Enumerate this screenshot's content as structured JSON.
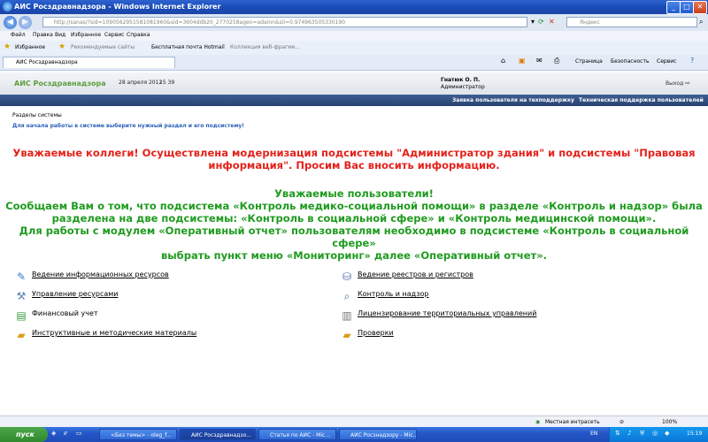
{
  "window": {
    "title": "АИС Росздравнадзора - Windows Internet Explorer"
  },
  "address_bar": {
    "url": "http://sanas/?sid=1090562951581081960&sid=3604ddb20_2770258agen=adainn&sil=0.974963505330190",
    "search_placeholder": "Яндекс"
  },
  "menu": {
    "items": [
      "Файл",
      "Правка",
      "Вид",
      "Избранное",
      "Сервис",
      "Справка"
    ]
  },
  "favorites_bar": {
    "favorites_label": "Избранное",
    "items": [
      "Рекомендуемые сайты",
      "Бесплатная почта Hotmail",
      "Коллекция веб-фрагме..."
    ]
  },
  "tabs": {
    "active": "АИС Росздравнадзора"
  },
  "command_bar": {
    "page": "Страница",
    "security": "Безопасность",
    "tools": "Сервис",
    "help_icon": "question-icon"
  },
  "site_header": {
    "name": "АИС Росздравнадзора",
    "date": "28 апреля 2012",
    "time": "15 39",
    "user_name": "Гнатюк О. П.",
    "user_role": "Администратор",
    "logout": "Выход"
  },
  "blue_strip": {
    "link1": "Заявка пользователя на техподдержку",
    "link2": "Техническая поддержка пользователей"
  },
  "content": {
    "sections_label": "Разделы системы",
    "intro": "Для начала работы в системе выберите нужный раздел и его подсистему!",
    "red_line1": "Уважаемые коллеги! Осуществлена модернизация подсистемы \"Администратор здания\" и подсистемы \"Правовая",
    "red_line2": "информация\". Просим Вас вносить информацию.",
    "green_line1": "Уважаемые пользователи!",
    "green_line2": "Сообщаем Вам о том, что подсистема «Контроль медико-социальной помощи» в разделе «Контроль и надзор» была",
    "green_line3": "разделена на две подсистемы: «Контроль в социальной сфере» и «Контроль медицинской помощи».",
    "green_line4": "Для работы с модулем «Оперативный отчет» пользователям необходимо в подсистеме «Контроль в социальной сфере»",
    "green_line5": "выбрать пункт меню «Мониторинг» далее «Оперативный отчет».",
    "modules_left": [
      {
        "label": "Ведение информационных ресурсов",
        "icon": "pencil-paper-icon"
      },
      {
        "label": "Управление ресурсами",
        "icon": "tools-icon"
      },
      {
        "label": "Финансовый учет",
        "icon": "money-icon"
      },
      {
        "label": "Инструктивные и методические материалы",
        "icon": "folder-icon"
      }
    ],
    "modules_right": [
      {
        "label": "Ведение реестров и регистров",
        "icon": "database-icon"
      },
      {
        "label": "Контроль и надзор",
        "icon": "magnifier-icon"
      },
      {
        "label": "Лицензирование территориальных управлений",
        "icon": "server-icon"
      },
      {
        "label": "Проверки",
        "icon": "folder-icon"
      }
    ]
  },
  "status_bar": {
    "zone": "Местная интрасеть",
    "zoom": "100%"
  },
  "taskbar": {
    "start": "пуск",
    "tasks": [
      "<Без темы> - oleg_f...",
      "АИС Росздравнадзо...",
      "Статья по АИС - Mic...",
      "АИС Росзнадзору - Mic..."
    ],
    "lang": "EN",
    "clock": "15:19"
  }
}
